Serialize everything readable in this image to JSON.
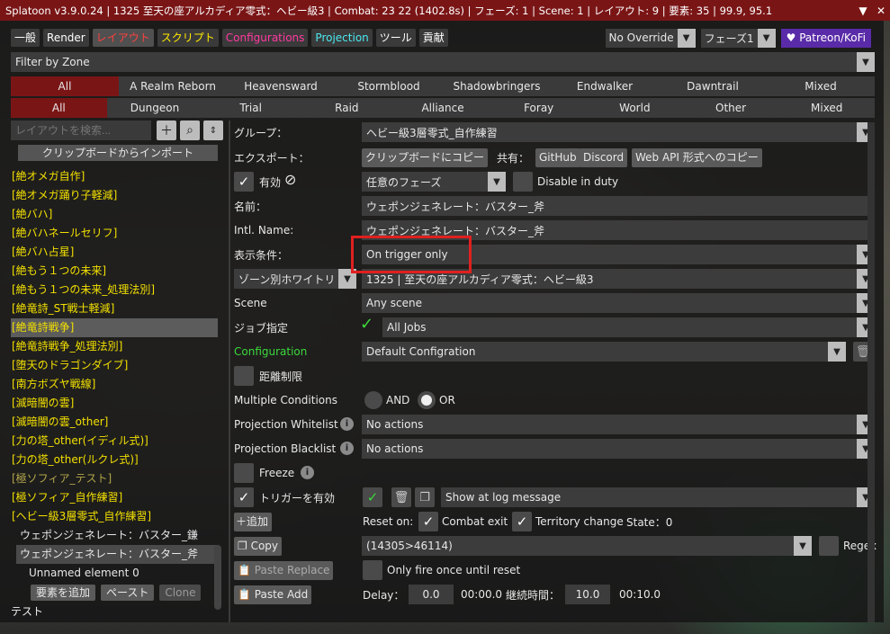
{
  "title": "Splatoon v3.9.0.24 | 1325 至天の座アルカディア零式：ヘビー級3 | Combat: 23 22 (1402.8s) | フェーズ: 1 | Scene: 1 | レイアウト: 9 | 要素: 35 | 99.9, 95.1",
  "titlebar_buttons": {
    "collapse": "▼",
    "close": "✕"
  },
  "tabs": [
    {
      "label": "一般",
      "color": "white"
    },
    {
      "label": "Render",
      "color": "white"
    },
    {
      "label": "レイアウト",
      "color": "red"
    },
    {
      "label": "スクリプト",
      "color": "yellow"
    },
    {
      "label": "Configurations",
      "color": "pink"
    },
    {
      "label": "Projection",
      "color": "cyan"
    },
    {
      "label": "ツール",
      "color": "white"
    },
    {
      "label": "貢献",
      "color": "white"
    }
  ],
  "top_right": {
    "override": "No Override",
    "phase": "フェーズ1",
    "patreon": "♥ Patreon/KoFi"
  },
  "filter": {
    "label": "Filter by Zone"
  },
  "expansions": [
    "All",
    "A Realm Reborn",
    "Heavensward",
    "Stormblood",
    "Shadowbringers",
    "Endwalker",
    "Dawntrail",
    "Mixed"
  ],
  "content_types": [
    "All",
    "Dungeon",
    "Trial",
    "Raid",
    "Alliance",
    "Foray",
    "World",
    "Other",
    "Mixed"
  ],
  "left": {
    "search_placeholder": "レイアウトを検索...",
    "import_button": "クリップボードからインポート",
    "layouts": [
      "[絶オメガ自作]",
      "[絶オメガ踊り子軽減]",
      "[絶バハ]",
      "[絶バハネールセリフ]",
      "[絶バハ占星]",
      "[絶もう１つの未来]",
      "[絶もう１つの未来_処理法別]",
      "[絶竜詩_ST戦士軽減]",
      "[絶竜詩戦争]",
      "[絶竜詩戦争_処理法別]",
      "[堕天のドラゴンダイブ]",
      "[南方ボズヤ戦線]",
      "[滅暗闇の雲]",
      "[滅暗闇の雲_other]",
      "[力の塔_other(イディル式)]",
      "[力の塔_other(ルクレ式)]",
      "[極ソフィア_テスト]",
      "[極ソフィア_自作練習]",
      "[ヘビー級3層零式_自作練習]"
    ],
    "sub_items": [
      "ウェポンジェネレート：バスター_鎌",
      "ウェポンジェネレート：バスター_斧",
      "Unnamed element 0"
    ],
    "element_buttons": {
      "add": "要素を追加",
      "paste": "ペースト",
      "clone": "Clone"
    },
    "bottom_item": "テスト"
  },
  "main": {
    "group_label": "グループ：",
    "group_value": "ヘビー級3層零式_自作練習",
    "export_label": "エクスポート：",
    "copy_clipboard": "クリップボードにコピー",
    "share_label": "共有：",
    "github": "GitHub",
    "discord": "Discord",
    "webapi": "Web API 形式へのコピー",
    "enabled_label": "有効",
    "phase_value": "任意のフェーズ",
    "disable_in_duty": "Disable in duty",
    "name_label": "名前：",
    "name_value": "ウェポンジェネレート：バスター_斧",
    "intl_label": "Intl. Name:",
    "intl_value": "ウェポンジェネレート：バスター_斧",
    "display_label": "表示条件：",
    "display_value": "On trigger only",
    "zone_wl": "ゾーン別ホワイトリ",
    "zone_value": "1325 | 至天の座アルカディア零式：ヘビー級3",
    "scene_label": "Scene",
    "scene_value": "Any scene",
    "job_label": "ジョブ指定",
    "job_value": "All Jobs",
    "config_label": "Configuration",
    "config_value": "Default Configration",
    "distance_label": "距離制限",
    "multi_label": "Multiple Conditions",
    "and_label": "AND",
    "or_label": "OR",
    "pw_label": "Projection Whitelist",
    "pw_value": "No actions",
    "pb_label": "Projection Blacklist",
    "pb_value": "No actions",
    "freeze_label": "Freeze",
    "trigger_label": "トリガーを有効",
    "trigger_value": "Show at log message",
    "add_label": "追加",
    "reset_on": "Reset on:",
    "combat_exit": "Combat exit",
    "territory_change": "Territory change",
    "state": "State：0",
    "copy_label": "Copy",
    "log_value": "(14305>46114)",
    "regex_label": "Regex",
    "paste_replace": "Paste Replace",
    "once_label": "Only fire once until reset",
    "paste_add": "Paste Add",
    "delay_label": "Delay：",
    "delay_value": "0.0",
    "delay_time": "00:00.0",
    "duration_label": "継続時間：",
    "duration_value": "10.0",
    "duration_time": "00:10.0"
  },
  "colors": {
    "titlebar": "#7a1516",
    "accent_green": "#3cd83c",
    "layout_yellow": "#f3e000",
    "highlight_red": "#e02020"
  }
}
